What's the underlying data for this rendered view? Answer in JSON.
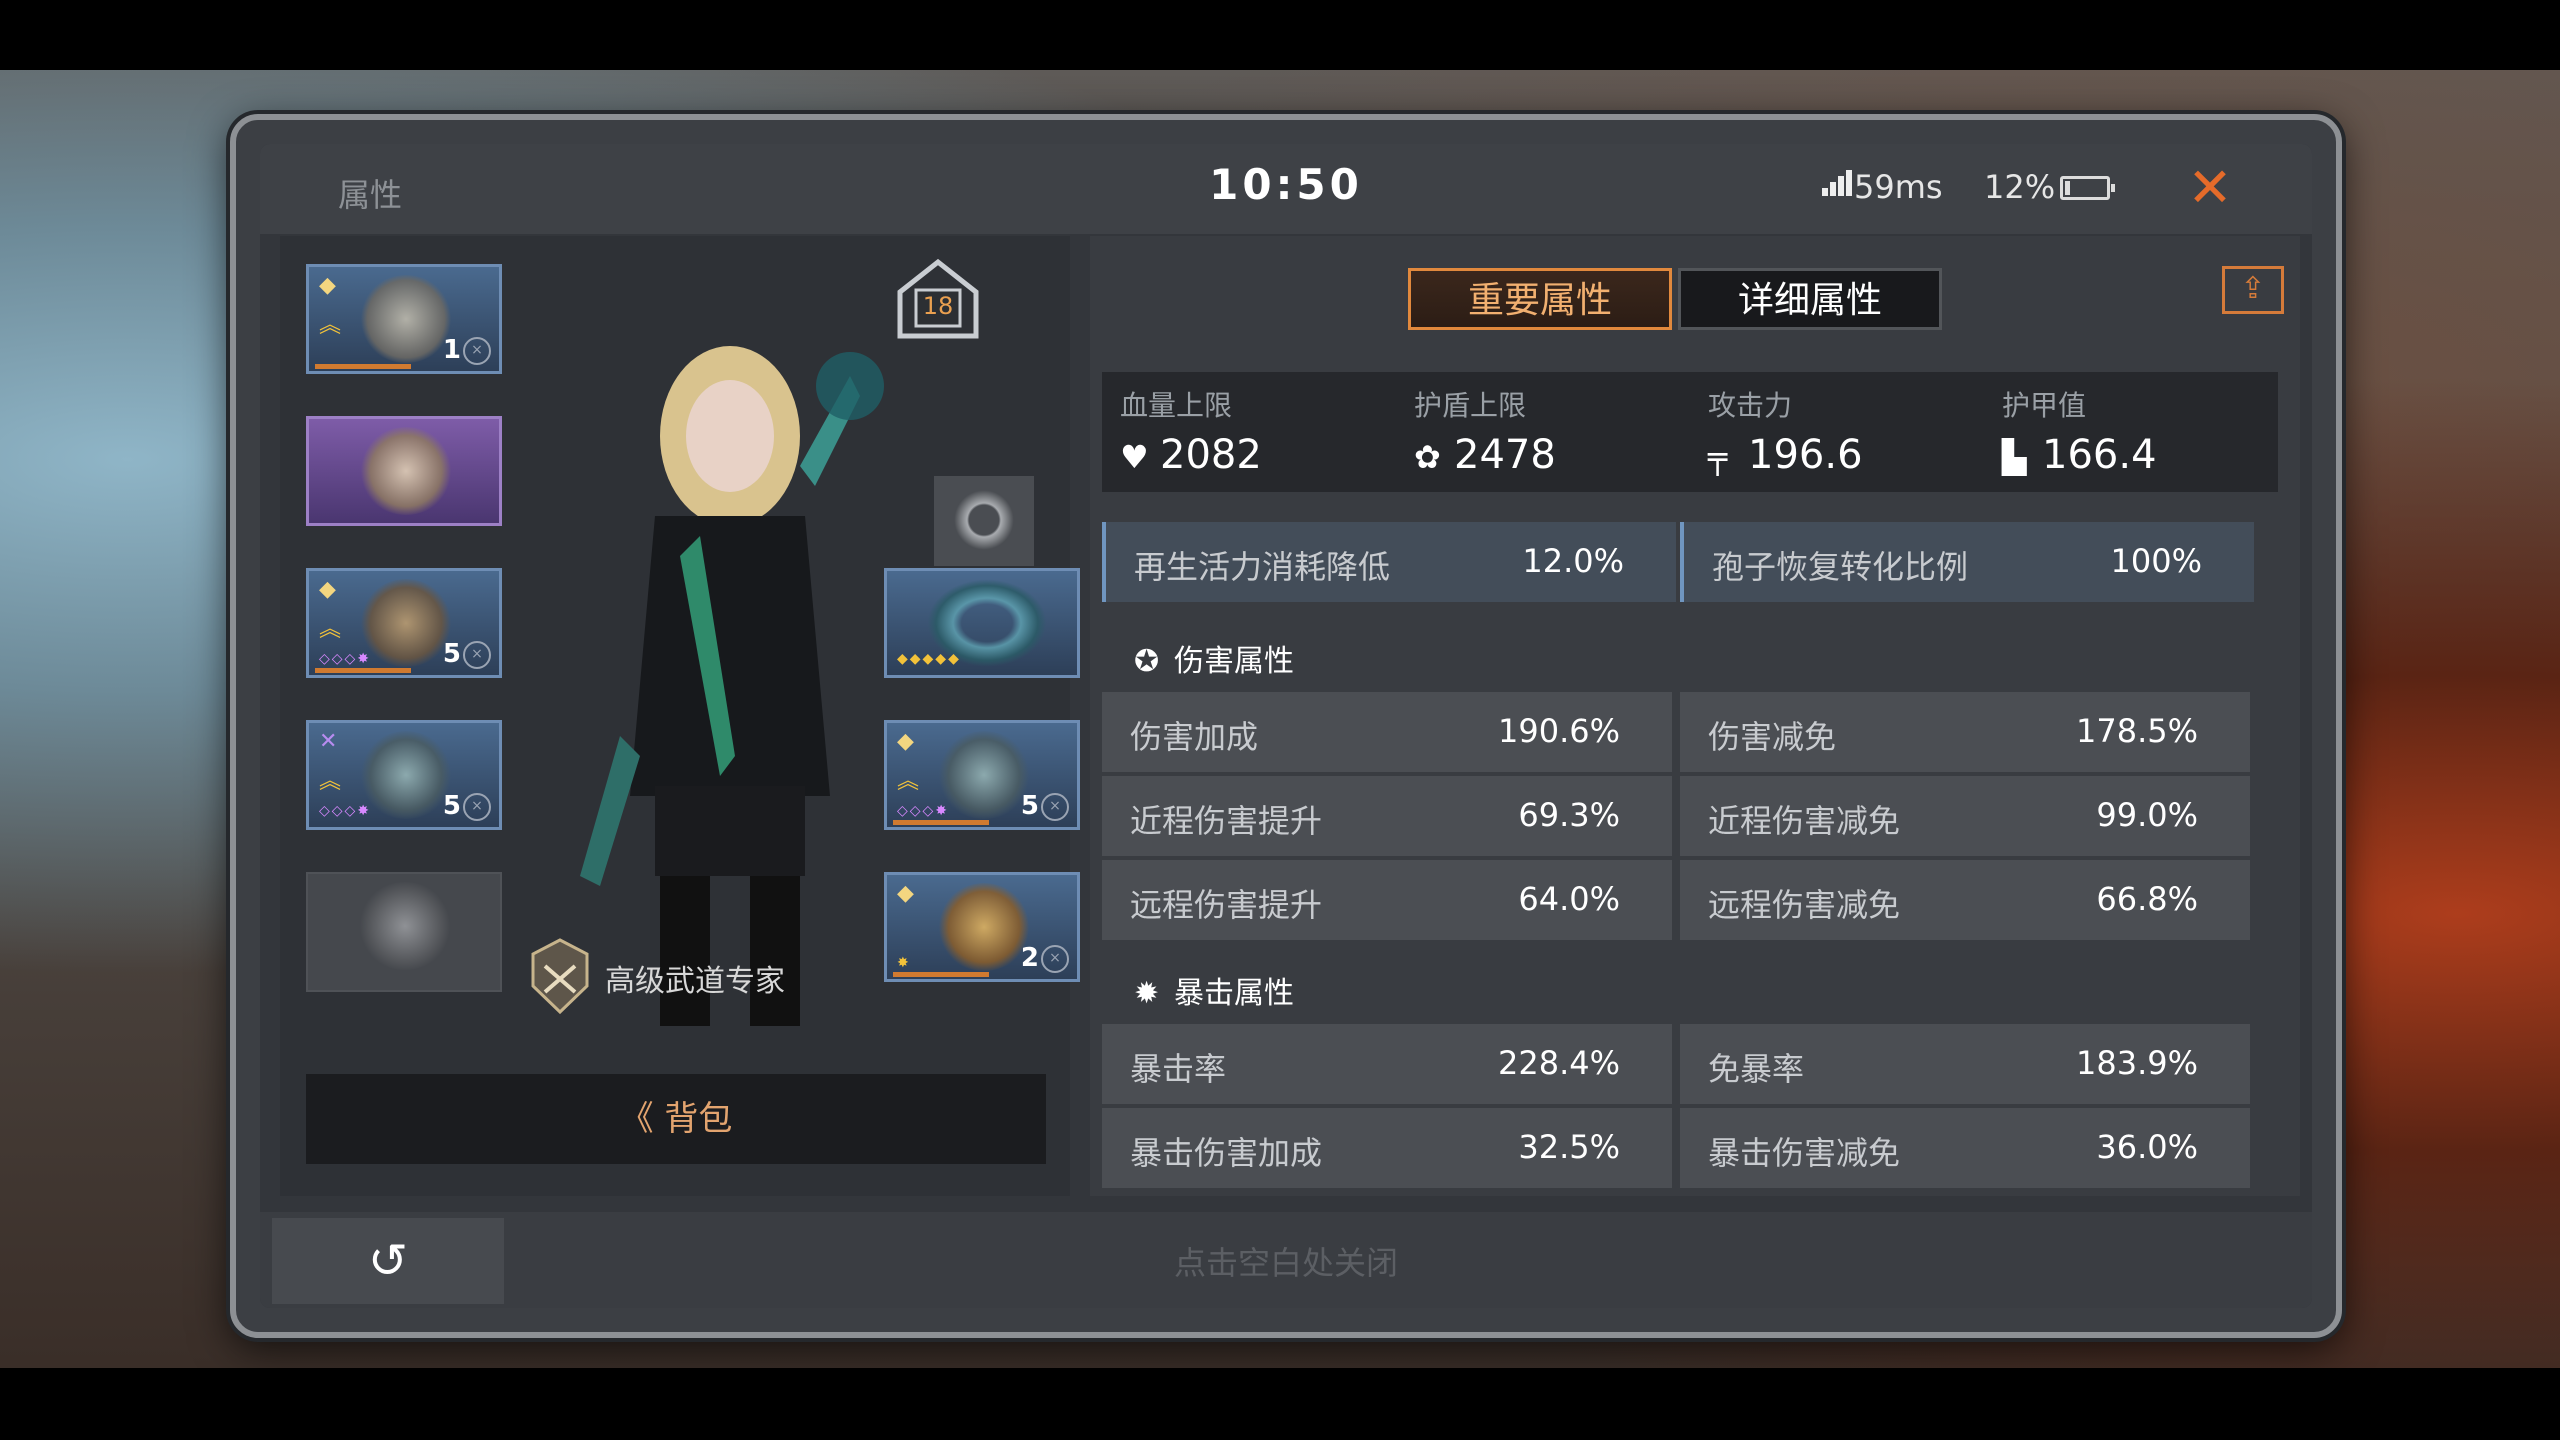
{
  "window": {
    "title": "属性",
    "time": "10:50",
    "ping": "59ms",
    "battery_percent": "12%",
    "battery_level": 0.12,
    "close_icon": "close-icon"
  },
  "equipment": {
    "level_badge": "18",
    "title_badge_text": "高级武道专家",
    "bag_button": "《 背包",
    "slots": [
      {
        "level": "1",
        "rarity": "blue"
      },
      {
        "level": "",
        "rarity": "purple"
      },
      {
        "level": "5",
        "rarity": "blue"
      },
      {
        "level": "5",
        "rarity": "blue"
      },
      {
        "level": "",
        "rarity": "empty"
      },
      {
        "level": "",
        "rarity": "empty"
      },
      {
        "level": "",
        "rarity": "blue"
      },
      {
        "level": "5",
        "rarity": "blue"
      },
      {
        "level": "2",
        "rarity": "blue"
      }
    ]
  },
  "tabs": {
    "important": "重要属性",
    "detailed": "详细属性"
  },
  "core_stats": [
    {
      "label": "血量上限",
      "value": "2082",
      "icon": "heart-icon"
    },
    {
      "label": "护盾上限",
      "value": "2478",
      "icon": "shield-icon"
    },
    {
      "label": "攻击力",
      "value": "196.6",
      "icon": "gun-icon"
    },
    {
      "label": "护甲值",
      "value": "166.4",
      "icon": "armor-icon"
    }
  ],
  "highlight_stats": [
    {
      "label": "再生活力消耗降低",
      "value": "12.0%"
    },
    {
      "label": "孢子恢复转化比例",
      "value": "100%"
    }
  ],
  "damage_section": {
    "title": "伤害属性",
    "rows": [
      {
        "label": "伤害加成",
        "value": "190.6%"
      },
      {
        "label": "伤害减免",
        "value": "178.5%"
      },
      {
        "label": "近程伤害提升",
        "value": "69.3%"
      },
      {
        "label": "近程伤害减免",
        "value": "99.0%"
      },
      {
        "label": "远程伤害提升",
        "value": "64.0%"
      },
      {
        "label": "远程伤害减免",
        "value": "66.8%"
      }
    ]
  },
  "crit_section": {
    "title": "暴击属性",
    "rows": [
      {
        "label": "暴击率",
        "value": "228.4%"
      },
      {
        "label": "免暴率",
        "value": "183.9%"
      },
      {
        "label": "暴击伤害加成",
        "value": "32.5%"
      },
      {
        "label": "暴击伤害减免",
        "value": "36.0%"
      }
    ]
  },
  "footer": {
    "back_icon": "back-arrow-icon",
    "hint": "点击空白处关闭"
  }
}
